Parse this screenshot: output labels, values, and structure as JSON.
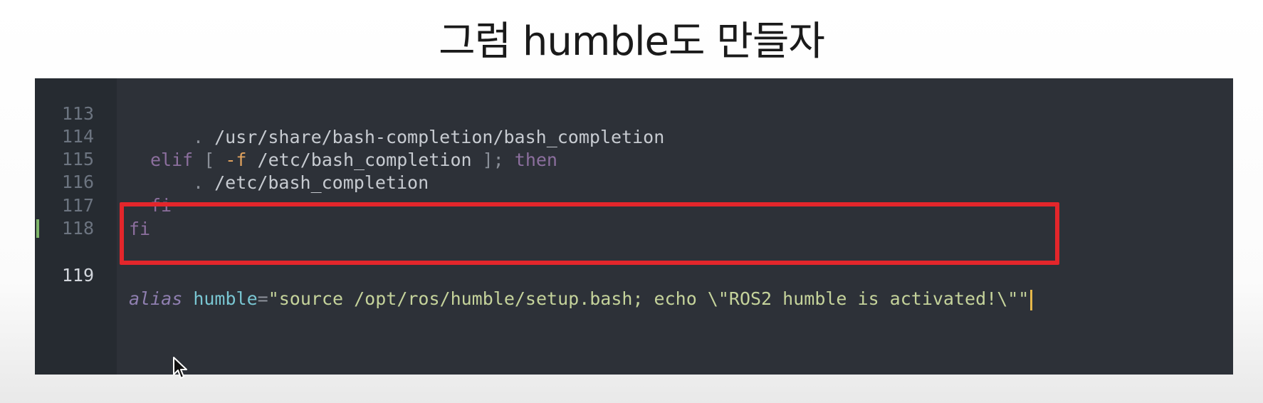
{
  "caption": "그럼 humble도 만들자",
  "editor": {
    "lines": [
      {
        "number": "113",
        "segments": [
          {
            "text": ". ",
            "kind": "punct"
          },
          {
            "text": "/usr/share/bash-completion/bash_completion",
            "kind": "plain"
          }
        ]
      },
      {
        "number": "114",
        "segments": [
          {
            "text": "elif ",
            "kind": "kw"
          },
          {
            "text": "[ ",
            "kind": "punct"
          },
          {
            "text": "-f",
            "kind": "flag"
          },
          {
            "text": " /etc/bash_completion ",
            "kind": "plain"
          },
          {
            "text": "]; ",
            "kind": "punct"
          },
          {
            "text": "then",
            "kind": "kw"
          }
        ]
      },
      {
        "number": "115",
        "segments": [
          {
            "text": ". ",
            "kind": "punct"
          },
          {
            "text": "/etc/bash_completion",
            "kind": "plain"
          }
        ]
      },
      {
        "number": "116",
        "segments": [
          {
            "text": "fi",
            "kind": "kw"
          }
        ]
      },
      {
        "number": "117",
        "segments": [
          {
            "text": "fi",
            "kind": "kw"
          }
        ]
      },
      {
        "number": "118",
        "segments": []
      },
      {
        "number": "119",
        "segments": [
          {
            "text": "alias",
            "kind": "kw-alias"
          },
          {
            "text": " ",
            "kind": "plain"
          },
          {
            "text": "humble",
            "kind": "var"
          },
          {
            "text": "=",
            "kind": "punct"
          },
          {
            "text": "\"source /opt/ros/humble/setup.bash; echo \\\"ROS2 humble is activated!\\\"\"",
            "kind": "str"
          }
        ]
      }
    ],
    "active_line": "119",
    "colors": {
      "background": "#2d3138",
      "gutter": "#262b31",
      "highlight_box": "#e3262b",
      "cursor": "#e5b74a",
      "modified_marker": "#7fb56a"
    }
  },
  "icons": {
    "mouse_pointer": "mouse-pointer-icon"
  }
}
